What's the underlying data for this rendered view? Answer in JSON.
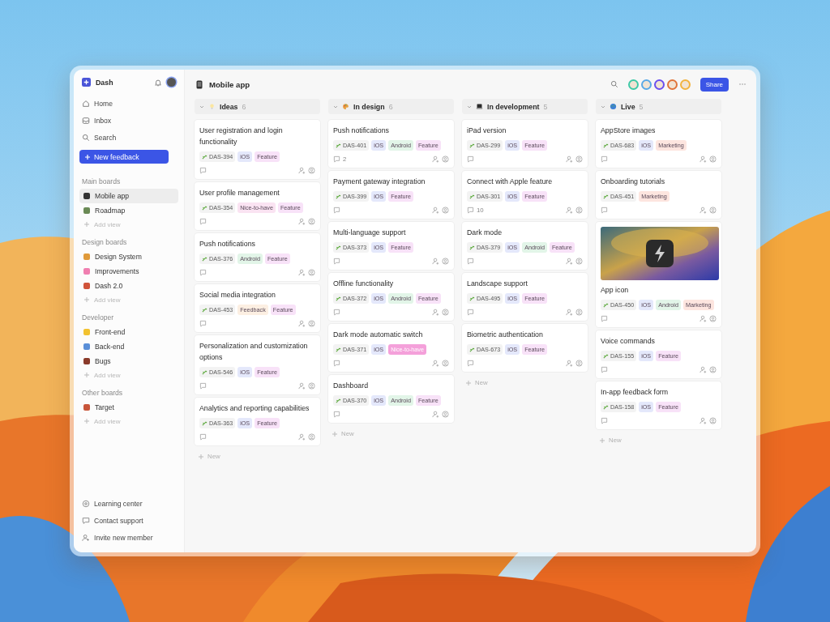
{
  "sidebar": {
    "workspace": "Dash",
    "nav": [
      {
        "label": "Home",
        "kind": "home"
      },
      {
        "label": "Inbox",
        "kind": "inbox"
      },
      {
        "label": "Search",
        "kind": "search"
      }
    ],
    "new_button": "New feedback",
    "sections": [
      {
        "title": "Main boards",
        "items": [
          {
            "label": "Mobile app",
            "selected": true
          },
          {
            "label": "Roadmap",
            "selected": false
          }
        ],
        "add": "Add view"
      },
      {
        "title": "Design boards",
        "items": [
          {
            "label": "Design System",
            "selected": false
          },
          {
            "label": "Improvements",
            "selected": false
          },
          {
            "label": "Dash 2.0",
            "selected": false
          }
        ],
        "add": "Add view"
      },
      {
        "title": "Developer",
        "items": [
          {
            "label": "Front-end",
            "selected": false
          },
          {
            "label": "Back-end",
            "selected": false
          },
          {
            "label": "Bugs",
            "selected": false
          }
        ],
        "add": "Add view"
      },
      {
        "title": "Other boards",
        "items": [
          {
            "label": "Target",
            "selected": false
          }
        ],
        "add": "Add view"
      }
    ],
    "footer": [
      {
        "label": "Learning center",
        "kind": "learn"
      },
      {
        "label": "Contact support",
        "kind": "chat"
      },
      {
        "label": "Invite new member",
        "kind": "invite"
      }
    ]
  },
  "header": {
    "title": "Mobile app",
    "avatars": [
      {
        "color": "#3ec9a7"
      },
      {
        "color": "#5aa9e6"
      },
      {
        "color": "#6a4ff0"
      },
      {
        "color": "#e0743a"
      },
      {
        "color": "#f2b33d"
      }
    ],
    "share": "Share"
  },
  "columns": [
    {
      "name": "Ideas",
      "count": "6",
      "new": "New",
      "cards": [
        {
          "title": "User registration and login functionality",
          "id": "DAS-394",
          "tags": [
            {
              "text": "iOS",
              "color": "#e4e8fb",
              "selected": false
            },
            {
              "text": "Feature",
              "color": "#f8e2f8",
              "selected": false
            }
          ]
        },
        {
          "title": "User profile management",
          "id": "DAS-354",
          "tags": [
            {
              "text": "Nice-to-have",
              "color": "#fae3f2",
              "selected": false
            },
            {
              "text": "Feature",
              "color": "#f8e2f8",
              "selected": false
            }
          ]
        },
        {
          "title": "Push notifications",
          "id": "DAS-376",
          "tags": [
            {
              "text": "Android",
              "color": "#e2f5e8",
              "selected": false
            },
            {
              "text": "Feature",
              "color": "#f8e2f8",
              "selected": false
            }
          ]
        },
        {
          "title": "Social media integration",
          "id": "DAS-453",
          "tags": [
            {
              "text": "Feedback",
              "color": "#fcefe2",
              "selected": false
            },
            {
              "text": "Feature",
              "color": "#f8e2f8",
              "selected": false
            }
          ]
        },
        {
          "title": "Personalization and customization options",
          "id": "DAS-546",
          "tags": [
            {
              "text": "iOS",
              "color": "#e4e8fb",
              "selected": false
            },
            {
              "text": "Feature",
              "color": "#f8e2f8",
              "selected": false
            }
          ]
        },
        {
          "title": "Analytics and reporting capabilities",
          "id": "DAS-363",
          "tags": [
            {
              "text": "iOS",
              "color": "#e4e8fb",
              "selected": false
            },
            {
              "text": "Feature",
              "color": "#f8e2f8",
              "selected": false
            }
          ]
        }
      ]
    },
    {
      "name": "In design",
      "count": "6",
      "new": "New",
      "cards": [
        {
          "title": "Push notifications",
          "id": "DAS-401",
          "comments": "2",
          "tags": [
            {
              "text": "iOS",
              "color": "#e4e8fb",
              "selected": false
            },
            {
              "text": "Android",
              "color": "#e2f5e8",
              "selected": false
            },
            {
              "text": "Feature",
              "color": "#f8e2f8",
              "selected": false
            }
          ]
        },
        {
          "title": "Payment gateway integration",
          "id": "DAS-399",
          "tags": [
            {
              "text": "iOS",
              "color": "#e4e8fb",
              "selected": false
            },
            {
              "text": "Feature",
              "color": "#f8e2f8",
              "selected": false
            }
          ]
        },
        {
          "title": "Multi-language support",
          "id": "DAS-373",
          "tags": [
            {
              "text": "iOS",
              "color": "#e4e8fb",
              "selected": false
            },
            {
              "text": "Feature",
              "color": "#f8e2f8",
              "selected": false
            }
          ]
        },
        {
          "title": "Offline functionality",
          "id": "DAS-372",
          "tags": [
            {
              "text": "iOS",
              "color": "#e4e8fb",
              "selected": false
            },
            {
              "text": "Android",
              "color": "#e2f5e8",
              "selected": false
            },
            {
              "text": "Feature",
              "color": "#f8e2f8",
              "selected": false
            }
          ]
        },
        {
          "title": "Dark mode automatic switch",
          "id": "DAS-371",
          "tags": [
            {
              "text": "iOS",
              "color": "#e4e8fb",
              "selected": false
            },
            {
              "text": "Nice-to-have",
              "color": "#f4a0da",
              "selected": true
            }
          ]
        },
        {
          "title": "Dashboard",
          "id": "DAS-370",
          "tags": [
            {
              "text": "iOS",
              "color": "#e4e8fb",
              "selected": false
            },
            {
              "text": "Android",
              "color": "#e2f5e8",
              "selected": false
            },
            {
              "text": "Feature",
              "color": "#f8e2f8",
              "selected": false
            }
          ]
        }
      ]
    },
    {
      "name": "In development",
      "count": "5",
      "new": "New",
      "cards": [
        {
          "title": "iPad version",
          "id": "DAS-299",
          "tags": [
            {
              "text": "iOS",
              "color": "#e4e8fb",
              "selected": false
            },
            {
              "text": "Feature",
              "color": "#f8e2f8",
              "selected": false
            }
          ]
        },
        {
          "title": "Connect with Apple feature",
          "id": "DAS-301",
          "comments": "10",
          "tags": [
            {
              "text": "iOS",
              "color": "#e4e8fb",
              "selected": false
            },
            {
              "text": "Feature",
              "color": "#f8e2f8",
              "selected": false
            }
          ]
        },
        {
          "title": "Dark mode",
          "id": "DAS-379",
          "tags": [
            {
              "text": "iOS",
              "color": "#e4e8fb",
              "selected": false
            },
            {
              "text": "Android",
              "color": "#e2f5e8",
              "selected": false
            },
            {
              "text": "Feature",
              "color": "#f8e2f8",
              "selected": false
            }
          ]
        },
        {
          "title": "Landscape support",
          "id": "DAS-495",
          "tags": [
            {
              "text": "iOS",
              "color": "#e4e8fb",
              "selected": false
            },
            {
              "text": "Feature",
              "color": "#f8e2f8",
              "selected": false
            }
          ]
        },
        {
          "title": "Biometric authentication",
          "id": "DAS-673",
          "tags": [
            {
              "text": "iOS",
              "color": "#e4e8fb",
              "selected": false
            },
            {
              "text": "Feature",
              "color": "#f8e2f8",
              "selected": false
            }
          ]
        }
      ]
    },
    {
      "name": "Live",
      "count": "5",
      "new": "New",
      "cards": [
        {
          "title": "AppStore images",
          "id": "DAS-683",
          "tags": [
            {
              "text": "iOS",
              "color": "#e4e8fb",
              "selected": false
            },
            {
              "text": "Marketing",
              "color": "#fde5df",
              "selected": false
            }
          ]
        },
        {
          "title": "Onboarding tutorials",
          "id": "DAS-451",
          "tags": [
            {
              "text": "Marketing",
              "color": "#fde5df",
              "selected": false
            }
          ]
        },
        {
          "title": "App icon",
          "id": "DAS-450",
          "has_picture": true,
          "tags": [
            {
              "text": "iOS",
              "color": "#e4e8fb",
              "selected": false
            },
            {
              "text": "Android",
              "color": "#e2f5e8",
              "selected": false
            },
            {
              "text": "Marketing",
              "color": "#fde5df",
              "selected": false
            }
          ]
        },
        {
          "title": "Voice commands",
          "id": "DAS-155",
          "tags": [
            {
              "text": "iOS",
              "color": "#e4e8fb",
              "selected": false
            },
            {
              "text": "Feature",
              "color": "#f8e2f8",
              "selected": false
            }
          ]
        },
        {
          "title": "In-app feedback form",
          "id": "DAS-158",
          "tags": [
            {
              "text": "iOS",
              "color": "#e4e8fb",
              "selected": false
            },
            {
              "text": "Feature",
              "color": "#f8e2f8",
              "selected": false
            }
          ]
        }
      ]
    }
  ]
}
